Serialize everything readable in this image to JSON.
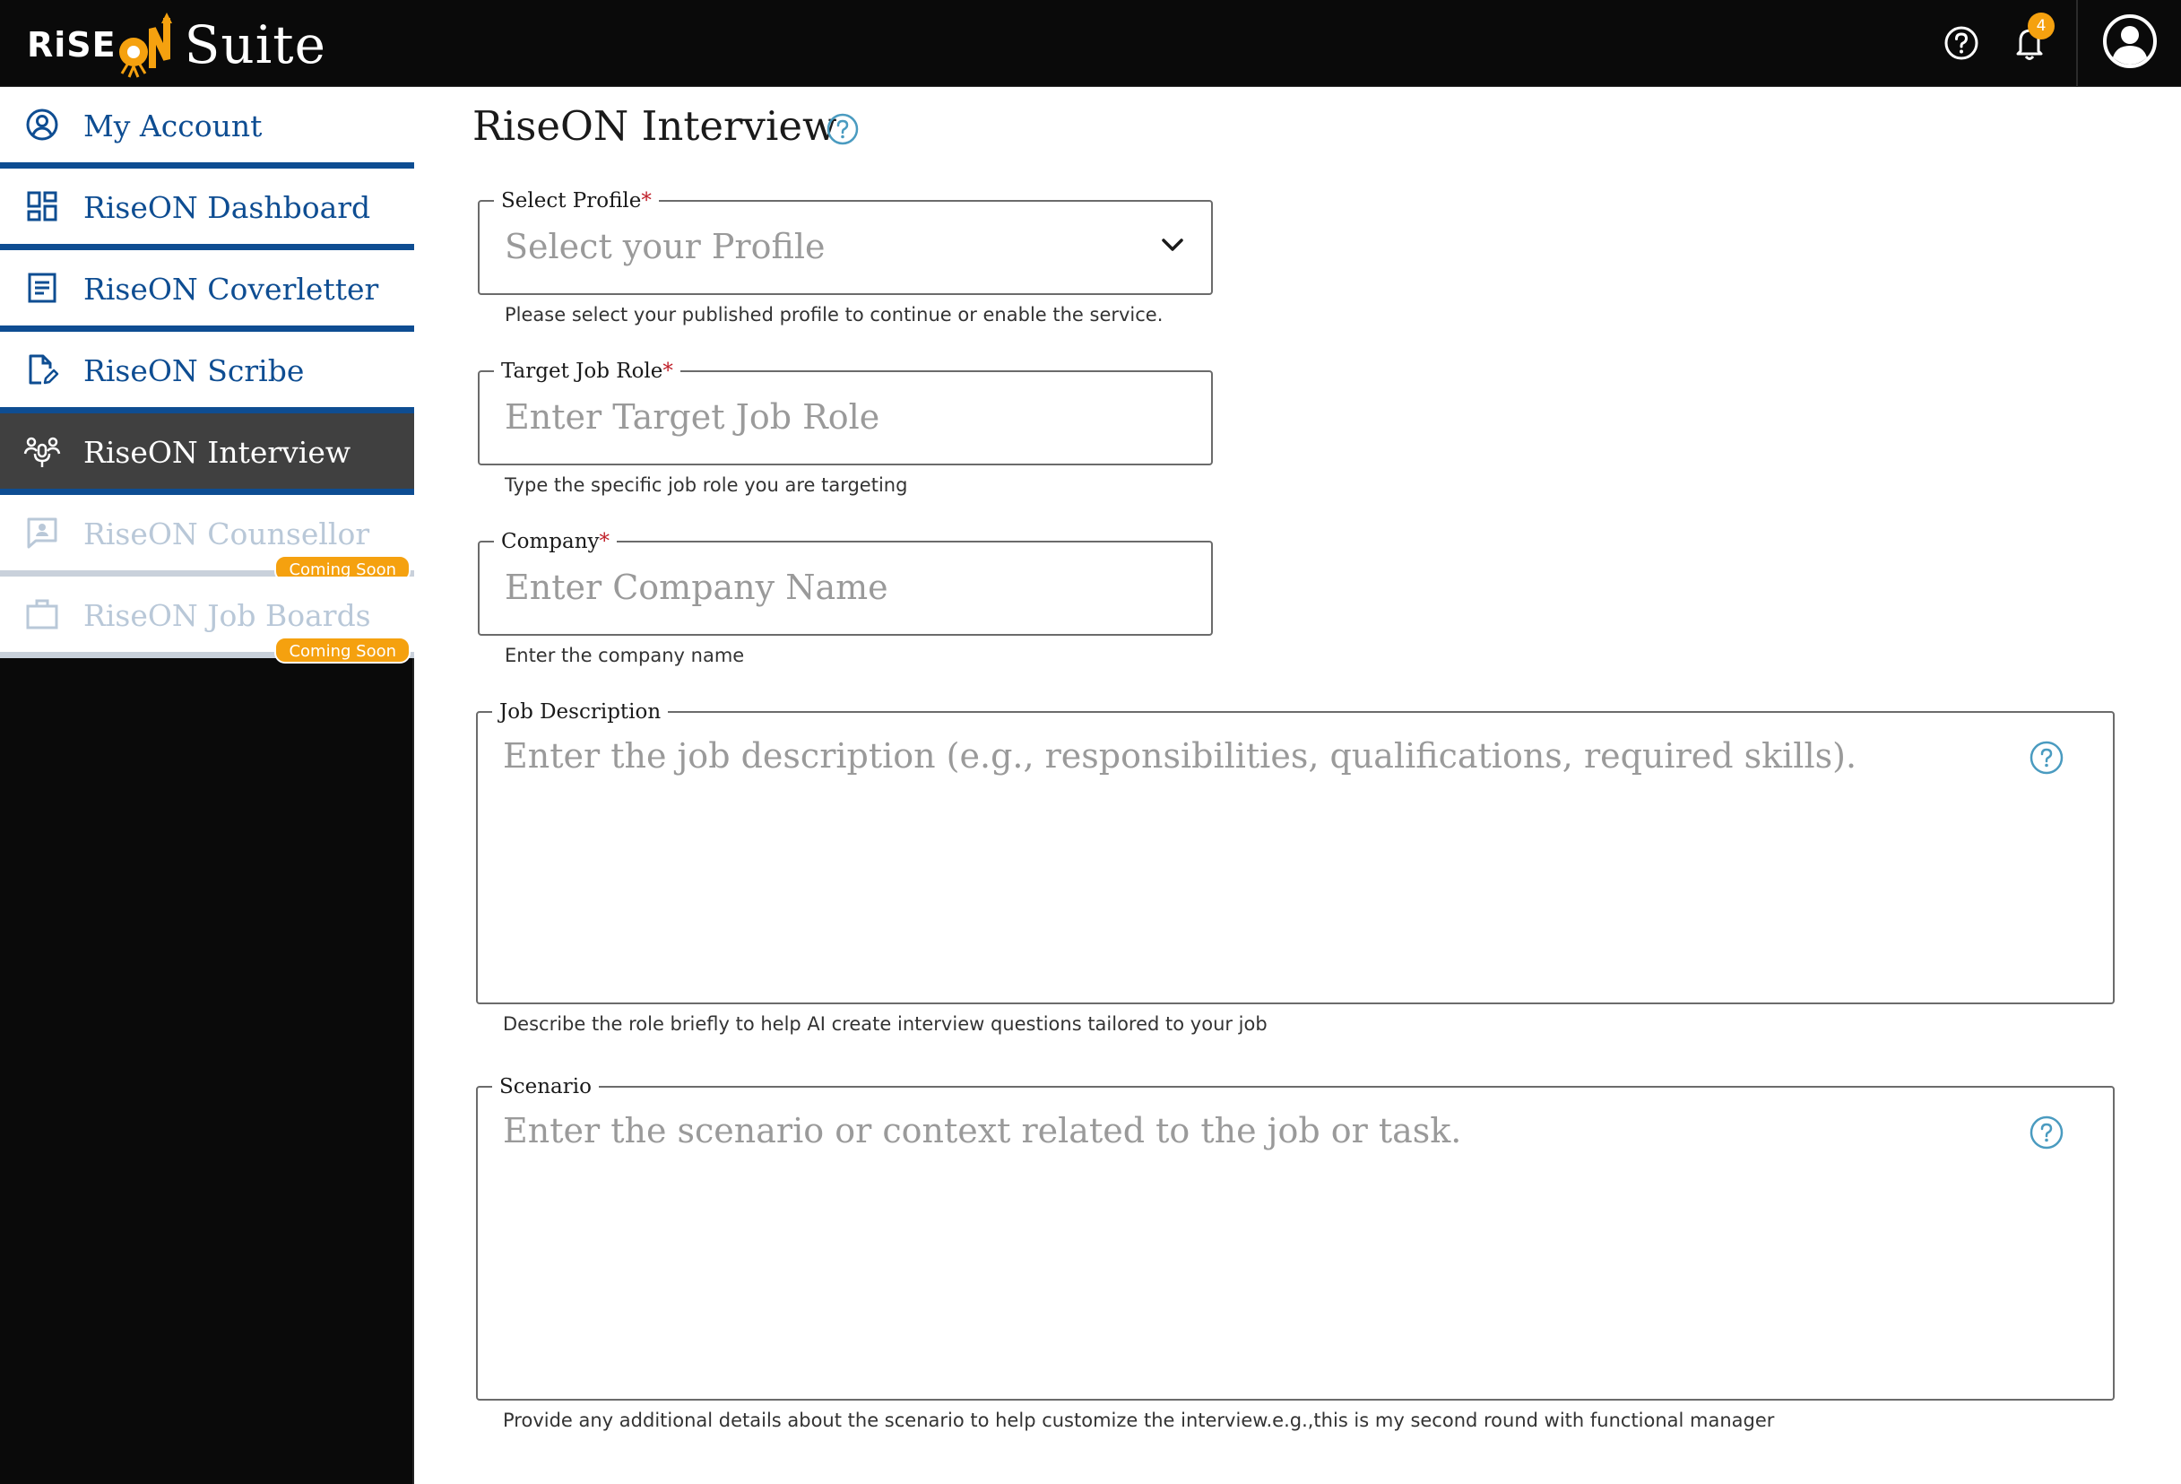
{
  "brand": {
    "rise": "RiSE",
    "on": "ON",
    "suite": "Suite"
  },
  "header": {
    "notification_count": "4",
    "icons": [
      "help-icon",
      "bell-icon",
      "user-avatar-icon"
    ]
  },
  "sidebar": {
    "items": [
      {
        "label": "My Account",
        "icon": "user-circle-icon",
        "state": "normal"
      },
      {
        "label": "RiseON Dashboard",
        "icon": "dashboard-grid-icon",
        "state": "normal"
      },
      {
        "label": "RiseON Coverletter",
        "icon": "document-lines-icon",
        "state": "normal"
      },
      {
        "label": "RiseON Scribe",
        "icon": "file-edit-icon",
        "state": "normal"
      },
      {
        "label": "RiseON Interview",
        "icon": "people-mic-icon",
        "state": "active"
      },
      {
        "label": "RiseON Counsellor",
        "icon": "chat-person-icon",
        "state": "disabled",
        "badge": "Coming Soon"
      },
      {
        "label": "RiseON Job Boards",
        "icon": "briefcase-icon",
        "state": "disabled",
        "badge": "Coming Soon"
      }
    ]
  },
  "main": {
    "title": "RiseON Interview",
    "form": {
      "profile": {
        "label": "Select Profile",
        "required_mark": "*",
        "placeholder": "Select your Profile",
        "helper": "Please select your published profile to continue or enable the service."
      },
      "job_role": {
        "label": "Target Job Role",
        "required_mark": "*",
        "placeholder": "Enter Target Job Role",
        "helper": "Type the specific job role you are targeting"
      },
      "company": {
        "label": "Company",
        "required_mark": "*",
        "placeholder": "Enter Company Name",
        "helper": "Enter the company name"
      },
      "job_description": {
        "label": "Job Description",
        "placeholder": "Enter the job description (e.g., responsibilities, qualifications, required skills).",
        "helper": "Describe the role briefly to help AI create interview questions tailored to your job"
      },
      "scenario": {
        "label": "Scenario",
        "placeholder": "Enter the scenario or context related to the job or task.",
        "helper": "Provide any additional details about the scenario to help customize the interview.e.g.,this is my second round with functional manager"
      }
    }
  },
  "colors": {
    "brand_blue": "#0e4d92",
    "accent_orange": "#f5a10f",
    "active_bg": "#404040",
    "sidebar_bg": "#0a0a0a",
    "disabled_text": "#b9c8d8",
    "required": "#c0202a"
  }
}
